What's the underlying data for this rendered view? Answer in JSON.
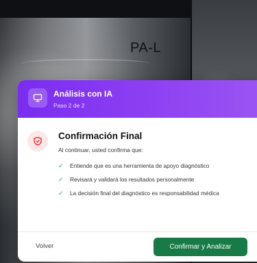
{
  "viewer": {
    "image_label": "PA-L"
  },
  "modal": {
    "header": {
      "title": "Análisis con IA",
      "step": "Paso 2 de 2",
      "icon": "monitor-icon"
    },
    "body": {
      "icon": "shield-icon",
      "title": "Confirmación Final",
      "intro": "Al continuar, usted confirma que:",
      "items": [
        {
          "icon": "check-icon",
          "text": "Entiende que es una herramienta de apoyo diagnóstico"
        },
        {
          "icon": "check-icon",
          "text": "Revisará y validará los resultados personalmente"
        },
        {
          "icon": "check-icon",
          "text": "La decisión final del diagnóstico es responsabilidad médica"
        }
      ]
    },
    "footer": {
      "back_label": "Volver",
      "confirm_label": "Confirmar y Analizar"
    }
  },
  "colors": {
    "header_accent": "#7a2cf0",
    "confirm_button": "#187a46",
    "check": "#2f9e44",
    "shield": "#e03131"
  }
}
